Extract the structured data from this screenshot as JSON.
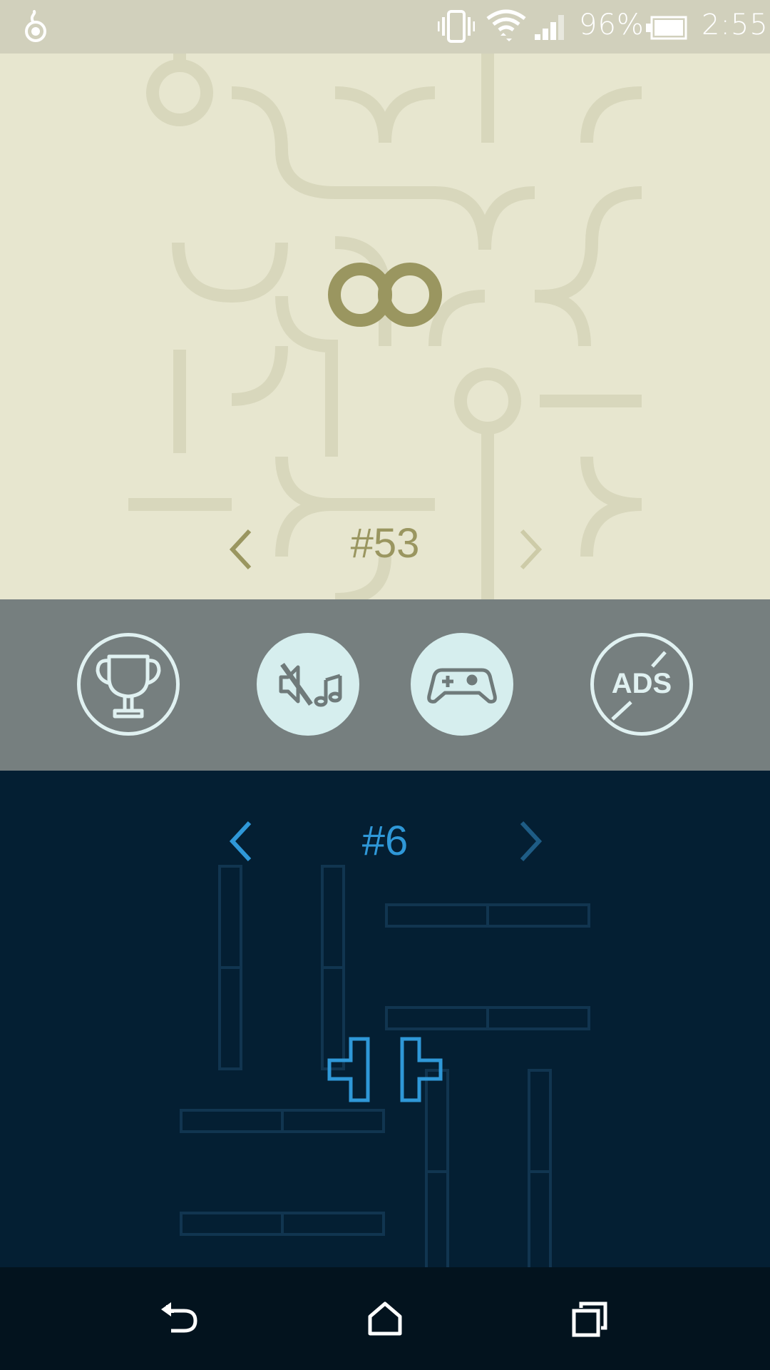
{
  "status_bar": {
    "battery_percent": "96%",
    "time": "2:55",
    "icons": [
      "app-notification-icon",
      "vibrate-icon",
      "wifi-icon",
      "signal-icon",
      "battery-icon"
    ]
  },
  "top_pack": {
    "level_label": "#53",
    "logo_icon": "infinity-icon",
    "accent_color": "#9a9660",
    "background_color": "#e7e6cf"
  },
  "toolbar": {
    "buttons": [
      {
        "name": "leaderboard",
        "icon": "trophy-icon",
        "style": "outline"
      },
      {
        "name": "sound-toggle",
        "icon": "sound-muted-music-icon",
        "style": "filled"
      },
      {
        "name": "game-services",
        "icon": "gamepad-icon",
        "style": "filled"
      },
      {
        "name": "remove-ads",
        "icon": "no-ads-icon",
        "label": "ADS",
        "style": "outline"
      }
    ]
  },
  "bottom_pack": {
    "level_label": "#6",
    "accent_color": "#2f98d8",
    "background_color": "#041f33"
  },
  "nav_bar": {
    "buttons": [
      "back-icon",
      "home-icon",
      "recents-icon"
    ]
  }
}
